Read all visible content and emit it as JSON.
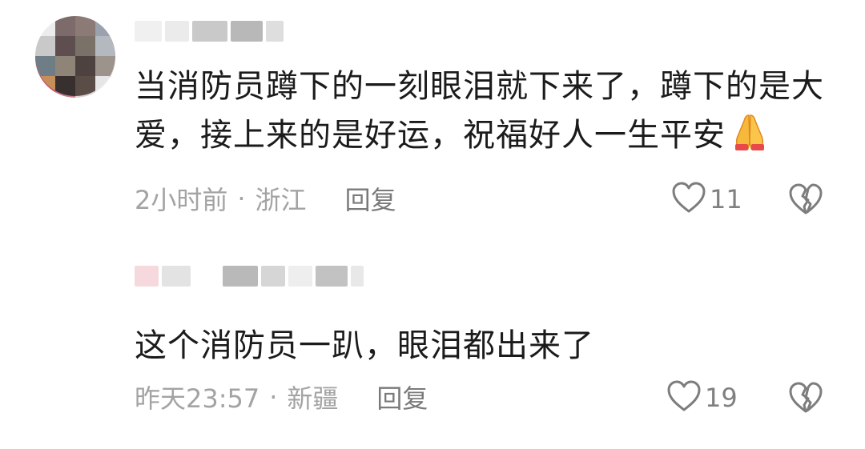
{
  "comments": [
    {
      "text": "当消防员蹲下的一刻眼泪就下来了，蹲下的是大爱，接上来的是好运，祝福好人一生平安",
      "emoji_icon": "folded-hands-icon",
      "time": "2小时前",
      "separator": "·",
      "location": "浙江",
      "reply_label": "回复",
      "like_count": "11",
      "like_icon": "heart-outline-icon",
      "dislike_icon": "broken-heart-icon"
    },
    {
      "text": "这个消防员一趴，眼泪都出来了",
      "time": "昨天23:57",
      "separator": "·",
      "location": "新疆",
      "reply_label": "回复",
      "like_count": "19",
      "like_icon": "heart-outline-icon",
      "dislike_icon": "broken-heart-icon"
    }
  ],
  "colors": {
    "text": "#1b1b1b",
    "meta": "#a3a3a3",
    "reply": "#7a7a7a",
    "icon": "#7d7d7d"
  }
}
